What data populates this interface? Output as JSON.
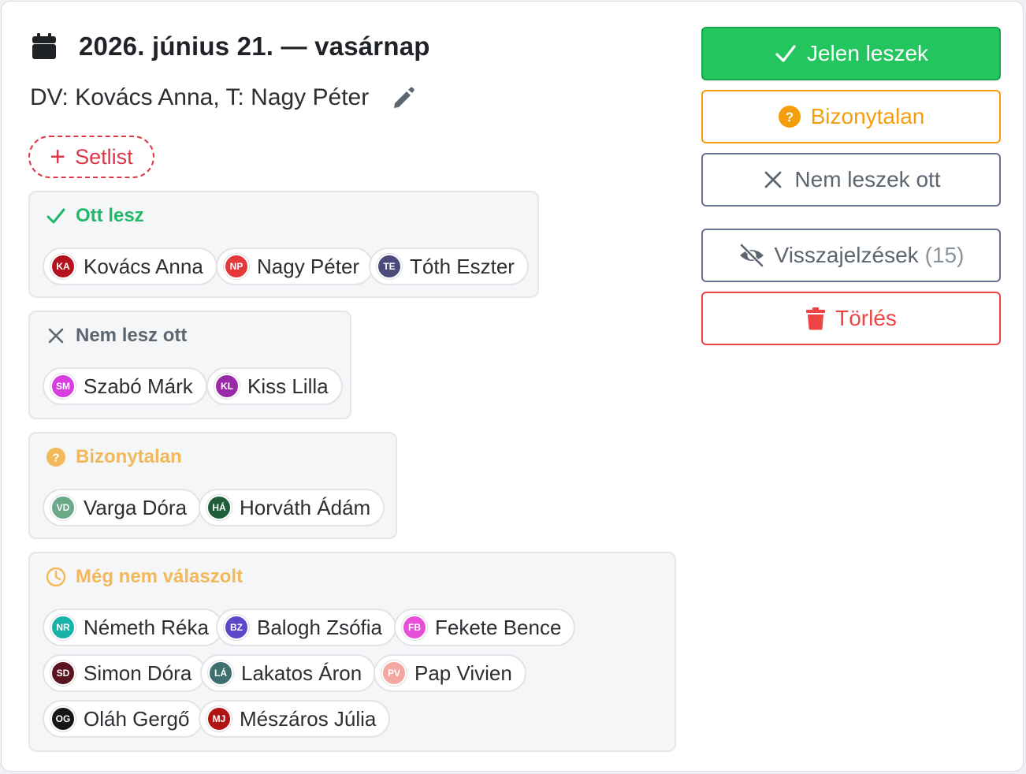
{
  "event": {
    "date": "2026. június 21. — vasárnap",
    "leaders": "DV: Kovács Anna, T: Nagy Péter",
    "setlist_label": "Setlist"
  },
  "groups": {
    "going": {
      "title": "Ott lesz",
      "color": "#22b86a",
      "members": [
        {
          "initials": "KA",
          "name": "Kovács Anna",
          "color": "#b3121e"
        },
        {
          "initials": "NP",
          "name": "Nagy Péter",
          "color": "#e5383b"
        },
        {
          "initials": "TE",
          "name": "Tóth Eszter",
          "color": "#4b4a7a"
        }
      ]
    },
    "not_going": {
      "title": "Nem lesz ott",
      "color": "#5c6670",
      "members": [
        {
          "initials": "SM",
          "name": "Szabó Márk",
          "color": "#d63ee0"
        },
        {
          "initials": "KL",
          "name": "Kiss Lilla",
          "color": "#9b2aa8"
        }
      ]
    },
    "unsure": {
      "title": "Bizonytalan",
      "color": "#f2b85a",
      "members": [
        {
          "initials": "VD",
          "name": "Varga Dóra",
          "color": "#6aa887"
        },
        {
          "initials": "HÁ",
          "name": "Horváth Ádám",
          "color": "#1e5e3a"
        }
      ]
    },
    "no_response": {
      "title": "Még nem válaszolt",
      "color": "#f2b85a",
      "members": [
        {
          "initials": "NR",
          "name": "Németh Réka",
          "color": "#18b3a8"
        },
        {
          "initials": "BZ",
          "name": "Balogh Zsófia",
          "color": "#5a48c8"
        },
        {
          "initials": "FB",
          "name": "Fekete Bence",
          "color": "#e84fd8"
        },
        {
          "initials": "SD",
          "name": "Simon Dóra",
          "color": "#5a1420"
        },
        {
          "initials": "LÁ",
          "name": "Lakatos Áron",
          "color": "#3e6e70"
        },
        {
          "initials": "PV",
          "name": "Pap Vivien",
          "color": "#f4a7a0"
        },
        {
          "initials": "OG",
          "name": "Oláh Gergő",
          "color": "#161616"
        },
        {
          "initials": "MJ",
          "name": "Mészáros Júlia",
          "color": "#b01515"
        }
      ]
    }
  },
  "actions": {
    "going_label": "Jelen leszek",
    "unsure_label": "Bizonytalan",
    "not_going_label": "Nem leszek ott",
    "feedback_label": "Visszajelzések",
    "feedback_count": "(15)",
    "delete_label": "Törlés"
  },
  "icons": {
    "calendar": "calendar-icon",
    "edit": "pencil-icon",
    "check": "check-icon",
    "x": "close-icon",
    "question": "question-circle-icon",
    "clock": "clock-icon",
    "eye_slash": "eye-slash-icon",
    "trash": "trash-icon"
  }
}
